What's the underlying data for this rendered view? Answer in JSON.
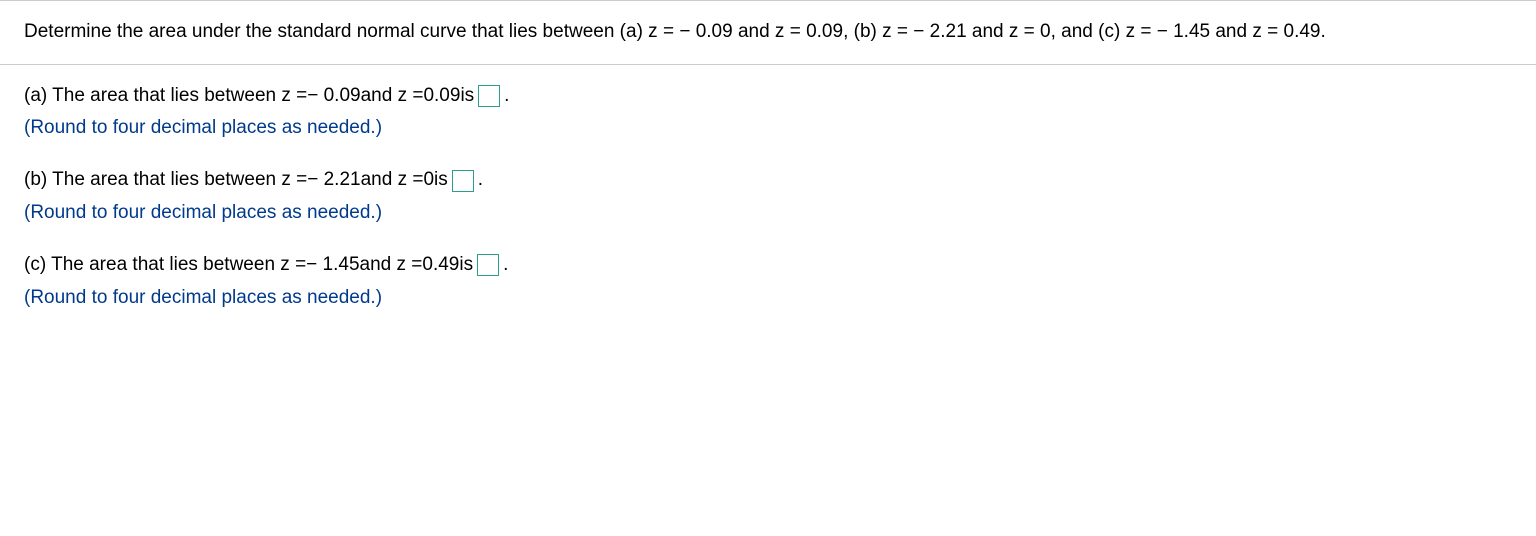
{
  "header": {
    "text": "Determine the area under the standard normal curve that lies between (a) z = − 0.09 and z = 0.09, (b) z = − 2.21 and z = 0, and (c) z = − 1.45 and z = 0.49."
  },
  "parts": {
    "a": {
      "prefix": "(a) The area that lies between z = ",
      "z1": "− 0.09",
      "mid": " and z = ",
      "z2": "0.09",
      "suffix": " is ",
      "period": ".",
      "instruction": "(Round to four decimal places as needed.)"
    },
    "b": {
      "prefix": "(b) The area that lies between z = ",
      "z1": "− 2.21",
      "mid": " and z = ",
      "z2": "0",
      "suffix": " is ",
      "period": ".",
      "instruction": "(Round to four decimal places as needed.)"
    },
    "c": {
      "prefix": "(c) The area that lies between z = ",
      "z1": "− 1.45",
      "mid": " and z = ",
      "z2": "0.49",
      "suffix": " is ",
      "period": ".",
      "instruction": "(Round to four decimal places as needed.)"
    }
  }
}
